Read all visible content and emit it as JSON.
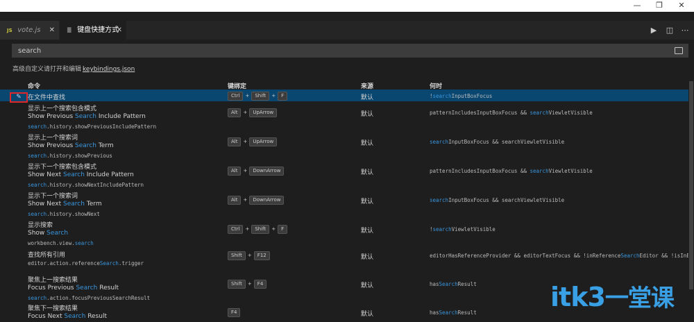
{
  "window": {
    "controls": [
      "—",
      "❐",
      "✕"
    ]
  },
  "tabs": [
    {
      "icon": "JS",
      "label": "vote.js",
      "close": "✕"
    },
    {
      "icon": "≣",
      "label": "键盘快捷方式",
      "close": "✕"
    }
  ],
  "actions": [
    "▶",
    "◫",
    "⋯"
  ],
  "search": {
    "value": "search"
  },
  "hint": {
    "text": "高级自定义请打开和编辑",
    "link": "keybindings.json"
  },
  "columns": {
    "command": "命令",
    "keybinding": "键绑定",
    "source": "来源",
    "when": "何时"
  },
  "rows": [
    {
      "title": "在文件中查找",
      "keys": [
        "Ctrl",
        "Shift",
        "F"
      ],
      "source": "默认",
      "when": [
        [
          "!",
          ""
        ],
        [
          "search",
          "hl"
        ],
        [
          "InputBoxFocus",
          ""
        ]
      ],
      "selected": true
    },
    {
      "title": "显示上一个搜索包含模式",
      "label": [
        [
          "Show Previous ",
          ""
        ],
        [
          "Search",
          "hl"
        ],
        [
          " Include Pattern",
          ""
        ]
      ],
      "id": [
        [
          "search",
          "hl"
        ],
        [
          ".history.showPreviousIncludePattern",
          ""
        ]
      ],
      "keys": [
        "Alt",
        "UpArrow"
      ],
      "source": "默认",
      "when": [
        [
          "patternIncludesInputBoxFocus && ",
          ""
        ],
        [
          "search",
          "hl"
        ],
        [
          "ViewletVisible",
          ""
        ]
      ]
    },
    {
      "title": "显示上一个搜索词",
      "label": [
        [
          "Show Previous ",
          ""
        ],
        [
          "Search",
          "hl"
        ],
        [
          " Term",
          ""
        ]
      ],
      "id": [
        [
          "search",
          "hl"
        ],
        [
          ".history.showPrevious",
          ""
        ]
      ],
      "keys": [
        "Alt",
        "UpArrow"
      ],
      "source": "默认",
      "when": [
        [
          "search",
          "hl"
        ],
        [
          "InputBoxFocus && searchViewletVisible",
          ""
        ]
      ]
    },
    {
      "title": "显示下一个搜索包含模式",
      "label": [
        [
          "Show Next ",
          ""
        ],
        [
          "Search",
          "hl"
        ],
        [
          " Include Pattern",
          ""
        ]
      ],
      "id": [
        [
          "search",
          "hl"
        ],
        [
          ".history.showNextIncludePattern",
          ""
        ]
      ],
      "keys": [
        "Alt",
        "DownArrow"
      ],
      "source": "默认",
      "when": [
        [
          "patternIncludesInputBoxFocus && ",
          ""
        ],
        [
          "search",
          "hl"
        ],
        [
          "ViewletVisible",
          ""
        ]
      ]
    },
    {
      "title": "显示下一个搜索词",
      "label": [
        [
          "Show Next ",
          ""
        ],
        [
          "Search",
          "hl"
        ],
        [
          " Term",
          ""
        ]
      ],
      "id": [
        [
          "search",
          "hl"
        ],
        [
          ".history.showNext",
          ""
        ]
      ],
      "keys": [
        "Alt",
        "DownArrow"
      ],
      "source": "默认",
      "when": [
        [
          "search",
          "hl"
        ],
        [
          "InputBoxFocus && searchViewletVisible",
          ""
        ]
      ]
    },
    {
      "title": "显示搜索",
      "label": [
        [
          "Show ",
          ""
        ],
        [
          "Search",
          "hl"
        ]
      ],
      "id": [
        [
          "workbench.view.",
          ""
        ],
        [
          "search",
          "hl"
        ]
      ],
      "keys": [
        "Ctrl",
        "Shift",
        "F"
      ],
      "source": "默认",
      "when": [
        [
          "!",
          ""
        ],
        [
          "search",
          "hl"
        ],
        [
          "ViewletVisible",
          ""
        ]
      ]
    },
    {
      "title": "查找所有引用",
      "id": [
        [
          "editor.action.reference",
          ""
        ],
        [
          "Search",
          "hl"
        ],
        [
          ".trigger",
          ""
        ]
      ],
      "keys": [
        "Shift",
        "F12"
      ],
      "source": "默认",
      "when": [
        [
          "editorHasReferenceProvider && editorTextFocus && !inReference",
          ""
        ],
        [
          "Search",
          "hl"
        ],
        [
          "Editor && !isInE...",
          ""
        ]
      ]
    },
    {
      "title": "聚焦上一搜索结果",
      "label": [
        [
          "Focus Previous ",
          ""
        ],
        [
          "Search",
          "hl"
        ],
        [
          " Result",
          ""
        ]
      ],
      "id": [
        [
          "search",
          "hl"
        ],
        [
          ".action.focusPreviousSearchResult",
          ""
        ]
      ],
      "keys": [
        "Shift",
        "F4"
      ],
      "source": "默认",
      "when": [
        [
          "has",
          ""
        ],
        [
          "Search",
          "hl"
        ],
        [
          "Result",
          ""
        ]
      ]
    },
    {
      "title": "聚焦下一搜索结果",
      "label": [
        [
          "Focus Next ",
          ""
        ],
        [
          "Search",
          "hl"
        ],
        [
          " Result",
          ""
        ]
      ],
      "keys": [
        "F4"
      ],
      "source": "默认",
      "when": [
        [
          "has",
          ""
        ],
        [
          "Search",
          "hl"
        ],
        [
          "Result",
          ""
        ]
      ]
    }
  ],
  "watermark": {
    "latin": "itk3",
    "cn": "一堂课"
  },
  "colors": {
    "background": "#1e1e1e",
    "selection": "#094771",
    "highlight": "#3a96dd",
    "annotation": "#e02828"
  }
}
